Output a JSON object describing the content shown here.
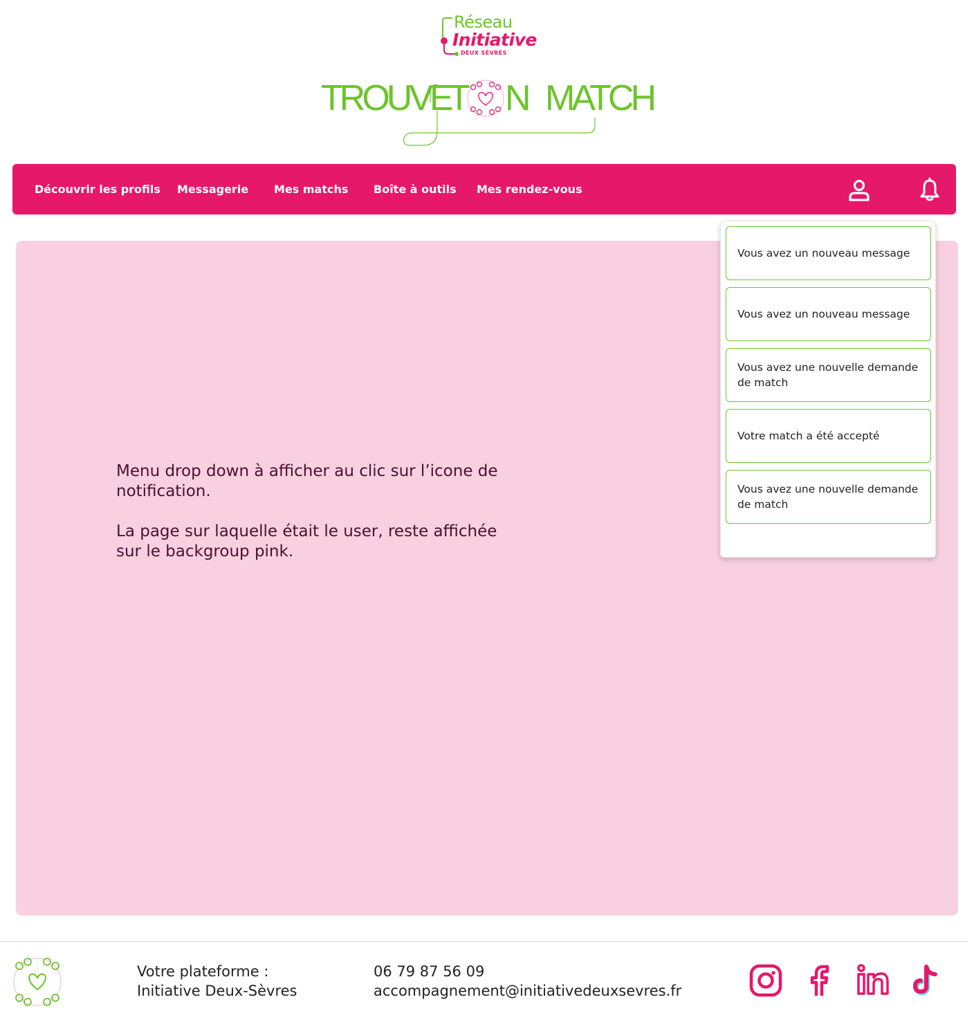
{
  "header": {
    "logo_reseau": {
      "line1": "Réseau",
      "line2": "Initiative",
      "line3": "DEUX SÈVRES"
    },
    "title_logo": {
      "word1": "TROUVE",
      "word2_t": "T",
      "word2_n": "N",
      "word3": "MATCH"
    }
  },
  "navbar": {
    "items": [
      {
        "label": "Découvrir les profils"
      },
      {
        "label": "Messagerie"
      },
      {
        "label": "Mes matchs"
      },
      {
        "label": "Boîte à outils"
      },
      {
        "label": "Mes rendez-vous"
      }
    ],
    "icons": {
      "profile": "user-icon",
      "notifications": "bell-icon"
    }
  },
  "main": {
    "note_line1": "Menu drop down à afficher au clic sur l’icone de notification.",
    "note_line2": "La page sur laquelle était le user, reste affichée sur le backgroup pink."
  },
  "notifications": [
    {
      "text": "Vous avez un nouveau message"
    },
    {
      "text": "Vous avez un nouveau message"
    },
    {
      "text": "Vous avez une nouvelle demande de match"
    },
    {
      "text": "Votre match a été accepté"
    },
    {
      "text": "Vous avez une nouvelle demande de match"
    }
  ],
  "footer": {
    "platform_label": "Votre plateforme :",
    "platform_name": "Initiative Deux-Sèvres",
    "phone": "06 79 87 56 09",
    "email": "accompagnement@initiativedeuxsevres.fr",
    "social": [
      "instagram-icon",
      "facebook-icon",
      "linkedin-icon",
      "tiktok-icon"
    ]
  },
  "colors": {
    "brand_pink": "#e5186a",
    "brand_green": "#6cc42a",
    "background_pink": "#f8d0e0",
    "text_dark": "#4a1030"
  }
}
